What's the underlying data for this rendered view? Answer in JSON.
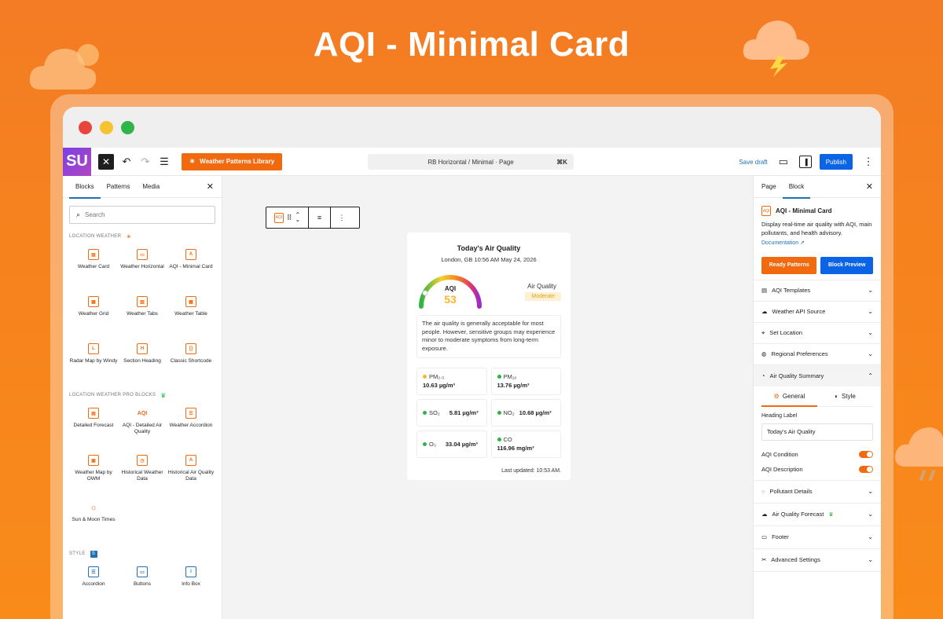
{
  "hero": {
    "title": "AQI - Minimal Card"
  },
  "toolbar": {
    "logo": "SU",
    "library_label": "Weather Patterns Library",
    "command_bar": "RB Horizontal / Minimal · Page",
    "command_shortcut": "⌘K",
    "save_draft": "Save draft",
    "publish": "Publish"
  },
  "left_panel": {
    "tabs": [
      "Blocks",
      "Patterns",
      "Media"
    ],
    "search_placeholder": "Search",
    "section1": "LOCATION WEATHER",
    "section1_blocks": [
      "Weather Card",
      "Weather Horizontal",
      "AQI - Minimal Card",
      "Weather Grid",
      "Weather Tabs",
      "Weather Table",
      "Radar Map by Windy",
      "Section Heading",
      "Classic Shortcode"
    ],
    "section2": "LOCATION WEATHER PRO BLOCKS",
    "section2_blocks": [
      "Detailed Forecast",
      "AQI - Detailed Air Quality",
      "Weather Accordion",
      "Weather Map by OWM",
      "Historical Weather Data",
      "Historical Air Quality Data",
      "Sun & Moon Times"
    ],
    "section3": "STYLE",
    "section3_blocks": [
      "Accordion",
      "Buttons",
      "Info Box"
    ]
  },
  "card": {
    "title": "Today's Air Quality",
    "subtitle": "London, GB 10:56 AM May 24, 2026",
    "aqi_label": "AQI",
    "aqi_value": "53",
    "aq_title": "Air Quality",
    "aq_status": "Moderate",
    "advice": "The air quality is generally acceptable for most people. However, sensitive groups may experience minor to moderate symptoms from long-term exposure.",
    "pollutants": [
      {
        "name": "PM₂.₅",
        "value": "10.63 µg/m³",
        "color": "#f5b82e"
      },
      {
        "name": "PM₁₀",
        "value": "13.76 µg/m³",
        "color": "#2fb344"
      },
      {
        "name": "SO₂",
        "value": "5.81 µg/m³",
        "color": "#2fb344"
      },
      {
        "name": "NO₂",
        "value": "10.68 µg/m³",
        "color": "#2fb344"
      },
      {
        "name": "O₃",
        "value": "33.04 µg/m³",
        "color": "#2fb344"
      },
      {
        "name": "CO",
        "value": "116.96 mg/m³",
        "color": "#2fb344"
      }
    ],
    "updated": "Last updated: 10:53 AM."
  },
  "right_panel": {
    "tabs": [
      "Page",
      "Block"
    ],
    "block_name": "AQI - Minimal Card",
    "description": "Display real-time air quality with AQI, main pollutants, and health advisory.",
    "doc_link": "Documentation ↗",
    "ready_patterns": "Ready Patterns",
    "block_preview": "Block Preview",
    "sections": [
      "AQI Templates",
      "Weather API Source",
      "Set Location",
      "Regional Preferences",
      "Air Quality Summary"
    ],
    "sub_tabs": [
      "General",
      "Style"
    ],
    "heading_label": "Heading Label",
    "heading_value": "Today's Air Quality",
    "toggles": [
      "AQI Condition",
      "AQI Description"
    ],
    "sections_after": [
      "Pollutant Details",
      "Air Quality Forecast",
      "Footer",
      "Advanced Settings"
    ]
  },
  "colors": {
    "accent": "#f26a0f",
    "blue": "#0b63e5",
    "link": "#2271b1"
  }
}
